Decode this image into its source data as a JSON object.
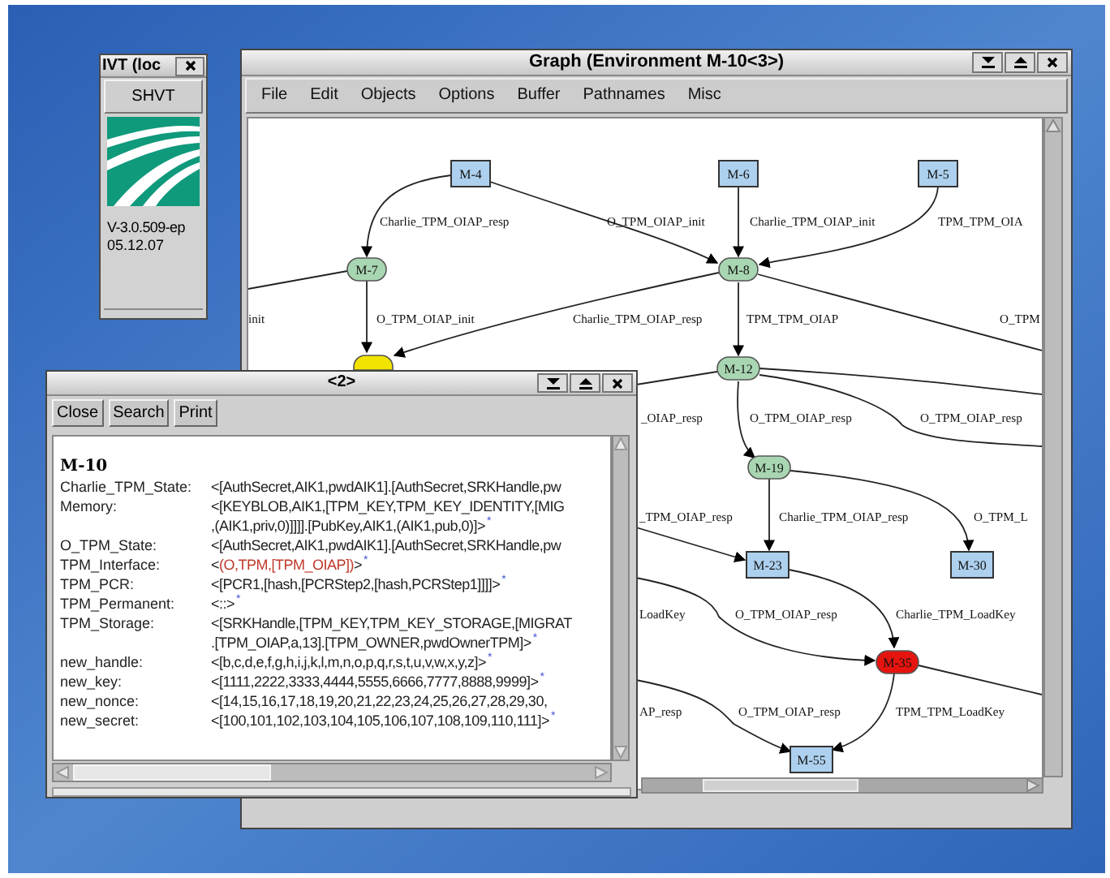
{
  "ivt_window": {
    "title": "IVT (loc",
    "button": "SHVT",
    "version": "V-3.0.509-ep",
    "date": "05.12.07"
  },
  "graph_window": {
    "title": "Graph (Environment M-10<3>)",
    "menu": [
      "File",
      "Edit",
      "Objects",
      "Options",
      "Buffer",
      "Pathnames",
      "Misc"
    ],
    "nodes": [
      {
        "label": "M-4",
        "kind": "box",
        "color": "#add0ee"
      },
      {
        "label": "M-6",
        "kind": "box",
        "color": "#add0ee"
      },
      {
        "label": "M-5",
        "kind": "box",
        "color": "#add0ee"
      },
      {
        "label": "M-7",
        "kind": "ellipse",
        "color": "#a9d6b2"
      },
      {
        "label": "M-8",
        "kind": "ellipse",
        "color": "#a9d6b2"
      },
      {
        "kind": "ellipse",
        "color": "#f2e400"
      },
      {
        "label": "M-12",
        "kind": "ellipse",
        "color": "#a9d6b2"
      },
      {
        "label": "M-19",
        "kind": "ellipse",
        "color": "#a9d6b2"
      },
      {
        "label": "M-23",
        "kind": "box",
        "color": "#add0ee"
      },
      {
        "label": "M-30",
        "kind": "box",
        "color": "#add0ee"
      },
      {
        "label": "M-35",
        "kind": "ellipse",
        "color": "#e5140e"
      },
      {
        "label": "M-55",
        "kind": "box",
        "color": "#add0ee"
      }
    ],
    "edge_labels": [
      "Charlie_TPM_OIAP_resp",
      "O_TPM_OIAP_init",
      "Charlie_TPM_OIAP_init",
      "TPM_TPM_OIA",
      "init",
      "O_TPM_OIAP_init",
      "Charlie_TPM_OIAP_resp",
      "TPM_TPM_OIAP",
      "O_TPM",
      "_OIAP_resp",
      "O_TPM_OIAP_resp",
      "O_TPM_OIAP_resp",
      "_TPM_OIAP_resp",
      "Charlie_TPM_OIAP_resp",
      "O_TPM_L",
      "LoadKey",
      "O_TPM_OIAP_resp",
      "Charlie_TPM_LoadKey",
      "AP_resp",
      "O_TPM_OIAP_resp",
      "TPM_TPM_LoadKey"
    ]
  },
  "text_window": {
    "title": "<2>",
    "buttons": [
      "Close",
      "Search",
      "Print"
    ],
    "heading": "M-10",
    "rows": [
      {
        "name": "Charlie_TPM_State:",
        "lines": [
          [
            {
              "text": "<[AuthSecret,AIK1,pwdAIK1].[AuthSecret,SRKHandle,pw",
              "changed": false
            }
          ]
        ]
      },
      {
        "name": "Memory:",
        "lines": [
          [
            {
              "text": "<[KEYBLOB,AIK1,[TPM_KEY,TPM_KEY_IDENTITY,[MIG",
              "changed": false
            }
          ],
          [
            {
              "text": ",(AIK1,priv,0)]]]].[PubKey,AIK1,(AIK1,pub,0)]>",
              "changed": false
            }
          ]
        ],
        "mark": "*"
      },
      {
        "name": "O_TPM_State:",
        "lines": [
          [
            {
              "text": "<[AuthSecret,AIK1,pwdAIK1].[AuthSecret,SRKHandle,pw",
              "changed": false
            }
          ]
        ]
      },
      {
        "name": "TPM_Interface:",
        "lines": [
          [
            {
              "text": "<",
              "changed": false
            },
            {
              "text": "(O,TPM,[TPM_OIAP])",
              "changed": true
            },
            {
              "text": ">",
              "changed": false
            }
          ]
        ],
        "mark": "*"
      },
      {
        "name": "TPM_PCR:",
        "lines": [
          [
            {
              "text": "<[PCR1,[hash,[PCRStep2,[hash,PCRStep1]]]]>",
              "changed": false
            }
          ]
        ],
        "mark": "*"
      },
      {
        "name": "TPM_Permanent:",
        "lines": [
          [
            {
              "text": "<::>",
              "changed": false
            }
          ]
        ],
        "mark": "*"
      },
      {
        "name": "TPM_Storage:",
        "lines": [
          [
            {
              "text": "<[SRKHandle,[TPM_KEY,TPM_KEY_STORAGE,[MIGRAT",
              "changed": false
            }
          ],
          [
            {
              "text": ".[TPM_OIAP,a,13].[TPM_OWNER,pwdOwnerTPM]>",
              "changed": false
            }
          ]
        ],
        "mark": "*"
      },
      {
        "name": "new_handle:",
        "lines": [
          [
            {
              "text": "<[b,c,d,e,f,g,h,i,j,k,l,m,n,o,p,q,r,s,t,u,v,w,x,y,z]>",
              "changed": false
            }
          ]
        ],
        "mark": "*"
      },
      {
        "name": "new_key:",
        "lines": [
          [
            {
              "text": "<[1111,2222,3333,4444,5555,6666,7777,8888,9999]>",
              "changed": false
            }
          ]
        ],
        "mark": "*"
      },
      {
        "name": "new_nonce:",
        "lines": [
          [
            {
              "text": "<[14,15,16,17,18,19,20,21,22,23,24,25,26,27,28,29,30,",
              "changed": false
            }
          ]
        ]
      },
      {
        "name": "new_secret:",
        "lines": [
          [
            {
              "text": "<[100,101,102,103,104,105,106,107,108,109,110,111]>",
              "changed": false
            }
          ]
        ],
        "mark": "*"
      }
    ]
  }
}
